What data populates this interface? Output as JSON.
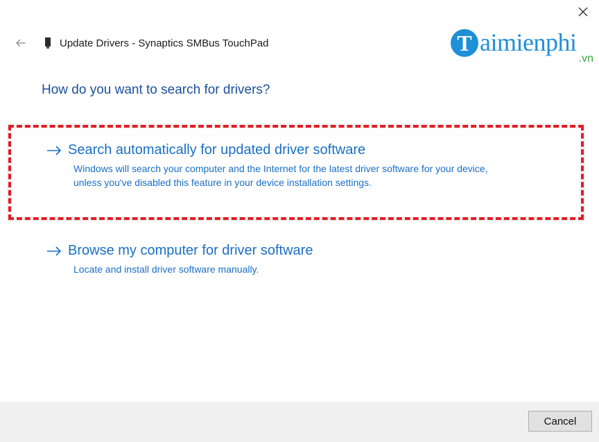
{
  "window": {
    "title": "Update Drivers - Synaptics SMBus TouchPad",
    "close_icon": "close-icon",
    "back_icon": "back-arrow-icon",
    "device_icon": "device-icon"
  },
  "watermark": {
    "logo_letter": "T",
    "text": "aimienphi",
    "suffix": ".vn",
    "colors": {
      "brand": "#1f8fd6",
      "suffix": "#3aa63a"
    }
  },
  "main": {
    "heading": "How do you want to search for drivers?",
    "options": [
      {
        "title": "Search automatically for updated driver software",
        "description": "Windows will search your computer and the Internet for the latest driver software for your device, unless you've disabled this feature in your device installation settings.",
        "highlighted": true
      },
      {
        "title": "Browse my computer for driver software",
        "description": "Locate and install driver software manually.",
        "highlighted": false
      }
    ]
  },
  "footer": {
    "cancel_label": "Cancel"
  },
  "colors": {
    "link": "#1a6fc4",
    "heading": "#1a4f9c",
    "highlight_border": "#e01d24"
  }
}
